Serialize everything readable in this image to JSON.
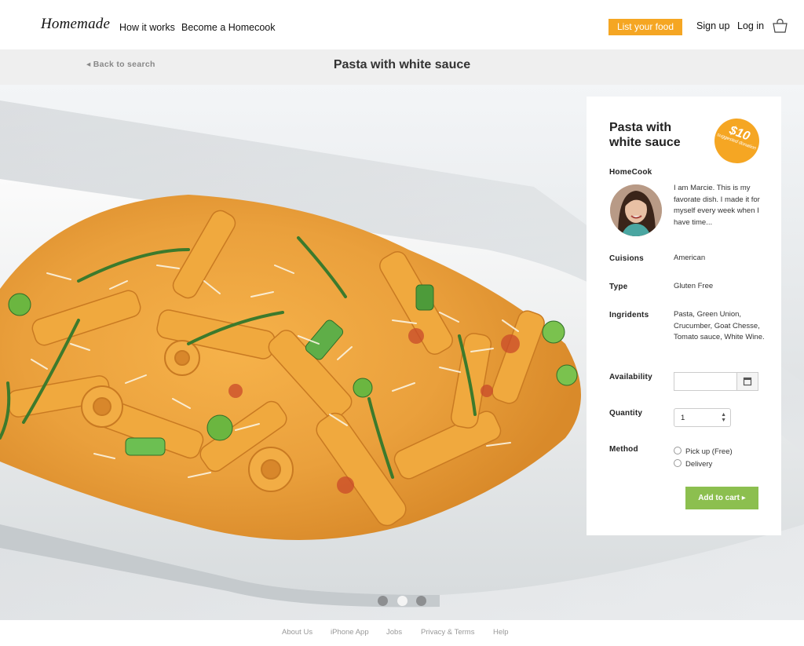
{
  "header": {
    "logo": "Homemade",
    "nav": [
      "How it works",
      "Become a Homecook"
    ],
    "list_button": "List your food",
    "sign_up": "Sign up",
    "log_in": "Log in",
    "cart_icon": "shopping-bag-icon"
  },
  "subheader": {
    "back_icon": "caret-left-icon",
    "back_label": "Back to search",
    "title": "Pasta with white sauce"
  },
  "carousel": {
    "active_index": 1,
    "dot_count": 3
  },
  "card": {
    "dish_name": "Pasta with white sauce",
    "price": "$10",
    "price_note": "suggested donation",
    "homecook_label": "HomeCook",
    "homecook_bio": "I am Marcie. This is my favorate dish. I made it for myself every week when I have time...",
    "cuisions_label": "Cuisions",
    "cuisions_value": "American",
    "type_label": "Type",
    "type_value": "Gluten Free",
    "ingredients_label": "Ingridents",
    "ingredients_value": "Pasta, Green Union, Crucumber, Goat Chesse, Tomato sauce, White Wine.",
    "availability_label": "Availability",
    "availability_value": "",
    "calendar_icon": "calendar-icon",
    "quantity_label": "Quantity",
    "quantity_value": "1",
    "method_label": "Method",
    "method_options": [
      "Pick up (Free)",
      "Delivery"
    ],
    "add_to_cart": "Add to cart",
    "accent_color": "#f5a623",
    "cta_color": "#8cbf4f"
  },
  "footer": {
    "links": [
      "About Us",
      "iPhone App",
      "Jobs",
      "Privacy & Terms",
      "Help"
    ]
  }
}
